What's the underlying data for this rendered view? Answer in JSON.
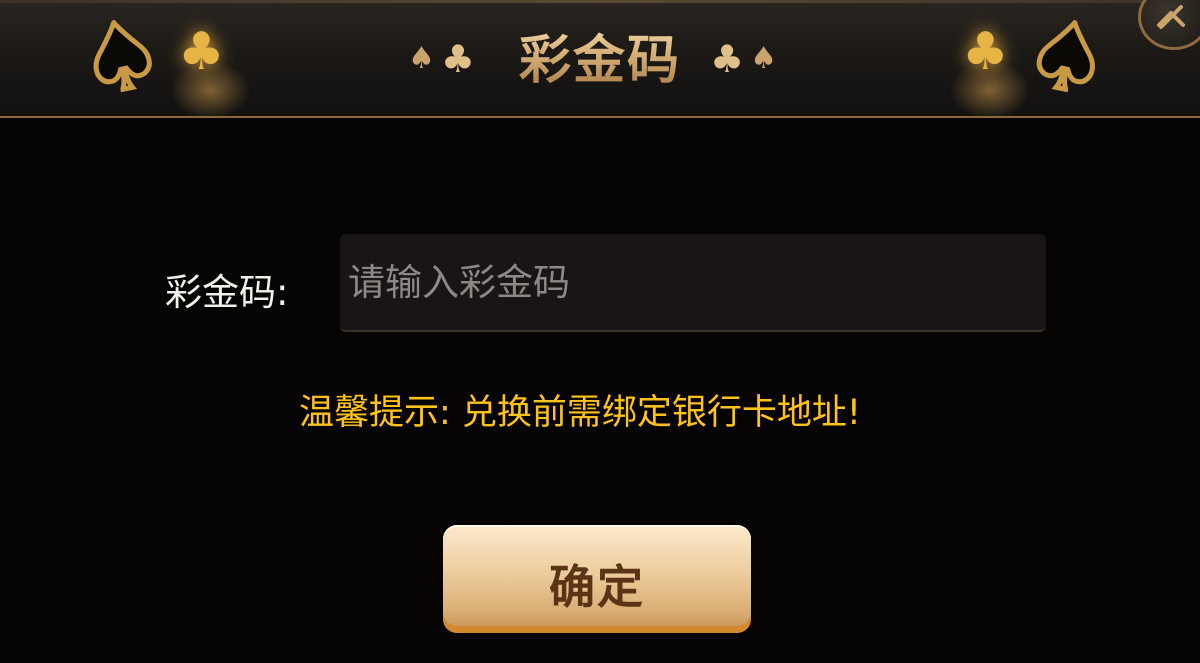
{
  "dialog": {
    "title": "彩金码",
    "decor_suits_left": [
      "♠",
      "♣"
    ],
    "decor_suits_right": [
      "♣",
      "♠"
    ]
  },
  "form": {
    "label": "彩金码:",
    "input_value": "",
    "input_placeholder": "请输入彩金码"
  },
  "tip": "温馨提示: 兑换前需绑定银行卡地址!",
  "buttons": {
    "confirm_label": "确定"
  },
  "icons": {
    "close": "close-icon",
    "corner_left": [
      "spade-icon",
      "club-icon"
    ],
    "corner_right": [
      "club-icon",
      "spade-icon"
    ]
  },
  "colors": {
    "title_gold": "#d8b27a",
    "tip_yellow": "#ffc21a",
    "button_gold": "#efd0a2",
    "button_text": "#5b3418",
    "background": "#060403"
  }
}
